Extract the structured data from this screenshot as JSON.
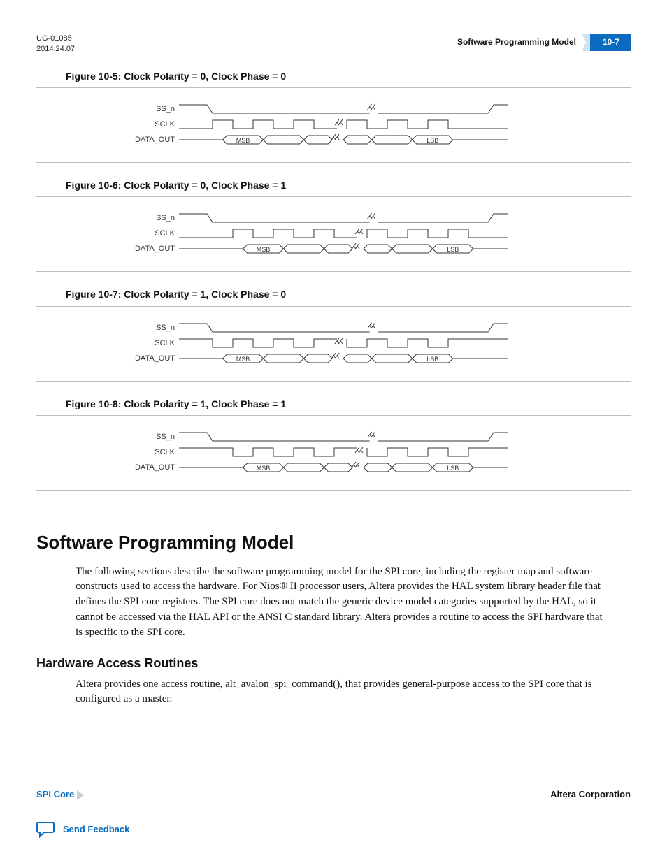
{
  "header": {
    "doc_id": "UG-01085",
    "date": "2014.24.07",
    "running_title": "Software Programming Model",
    "page_number": "10-7"
  },
  "figures": [
    {
      "caption": "Figure 10-5: Clock Polarity = 0, Clock Phase = 0",
      "variant": "pol0_ph0",
      "signals": {
        "ss": "SS_n",
        "sclk": "SCLK",
        "data": "DATA_OUT",
        "msb": "MSB",
        "lsb": "LSB"
      }
    },
    {
      "caption": "Figure 10-6: Clock Polarity = 0, Clock Phase = 1",
      "variant": "pol0_ph1",
      "signals": {
        "ss": "SS_n",
        "sclk": "SCLK",
        "data": "DATA_OUT",
        "msb": "MSB",
        "lsb": "LSB"
      }
    },
    {
      "caption": "Figure 10-7: Clock Polarity = 1, Clock Phase = 0",
      "variant": "pol1_ph0",
      "signals": {
        "ss": "SS_n",
        "sclk": "SCLK",
        "data": "DATA_OUT",
        "msb": "MSB",
        "lsb": "LSB"
      }
    },
    {
      "caption": "Figure 10-8: Clock Polarity = 1, Clock Phase = 1",
      "variant": "pol1_ph1",
      "signals": {
        "ss": "SS_n",
        "sclk": "SCLK",
        "data": "DATA_OUT",
        "msb": "MSB",
        "lsb": "LSB"
      }
    }
  ],
  "sections": {
    "h1": "Software Programming Model",
    "p1": "The following sections describe the software programming model for the SPI core, including the register map and software constructs used to access the hardware. For Nios® II processor users, Altera provides the HAL system library header file that defines the SPI core registers. The SPI core does not match the generic device model categories supported by the HAL, so it cannot be accessed via the HAL API or the ANSI C standard library. Altera provides a routine to access the SPI hardware that is specific to the SPI core.",
    "h2": "Hardware Access Routines",
    "p2a": "Altera provides one access routine, ",
    "routine": "alt_avalon_spi_command()",
    "p2b": ", that provides general-purpose access to the SPI core that is configured as a master."
  },
  "footer": {
    "left": "SPI Core",
    "right": "Altera Corporation",
    "feedback": "Send Feedback"
  },
  "chart_data": [
    {
      "type": "timing-diagram",
      "title": "Clock Polarity = 0, Clock Phase = 0",
      "idle_sclk": "low",
      "data_sample_edge": "rising",
      "signals": [
        "SS_n",
        "SCLK",
        "DATA_OUT"
      ],
      "ss_n": "high→low (active)…low→high",
      "sclk": "idles low; pulses high per bit while SS_n low",
      "data_out": "MSB first … LSB last; cells aligned to SCLK periods"
    },
    {
      "type": "timing-diagram",
      "title": "Clock Polarity = 0, Clock Phase = 1",
      "idle_sclk": "low",
      "data_sample_edge": "falling",
      "signals": [
        "SS_n",
        "SCLK",
        "DATA_OUT"
      ],
      "data_out": "MSB first … LSB last; data cells shifted half-period vs Phase=0"
    },
    {
      "type": "timing-diagram",
      "title": "Clock Polarity = 1, Clock Phase = 0",
      "idle_sclk": "high",
      "data_sample_edge": "falling",
      "signals": [
        "SS_n",
        "SCLK",
        "DATA_OUT"
      ],
      "sclk": "idles high; pulses low per bit while SS_n low"
    },
    {
      "type": "timing-diagram",
      "title": "Clock Polarity = 1, Clock Phase = 1",
      "idle_sclk": "high",
      "data_sample_edge": "rising",
      "signals": [
        "SS_n",
        "SCLK",
        "DATA_OUT"
      ],
      "sclk": "idles high; pulses low per bit; data shifted half-period vs Phase=0"
    }
  ]
}
